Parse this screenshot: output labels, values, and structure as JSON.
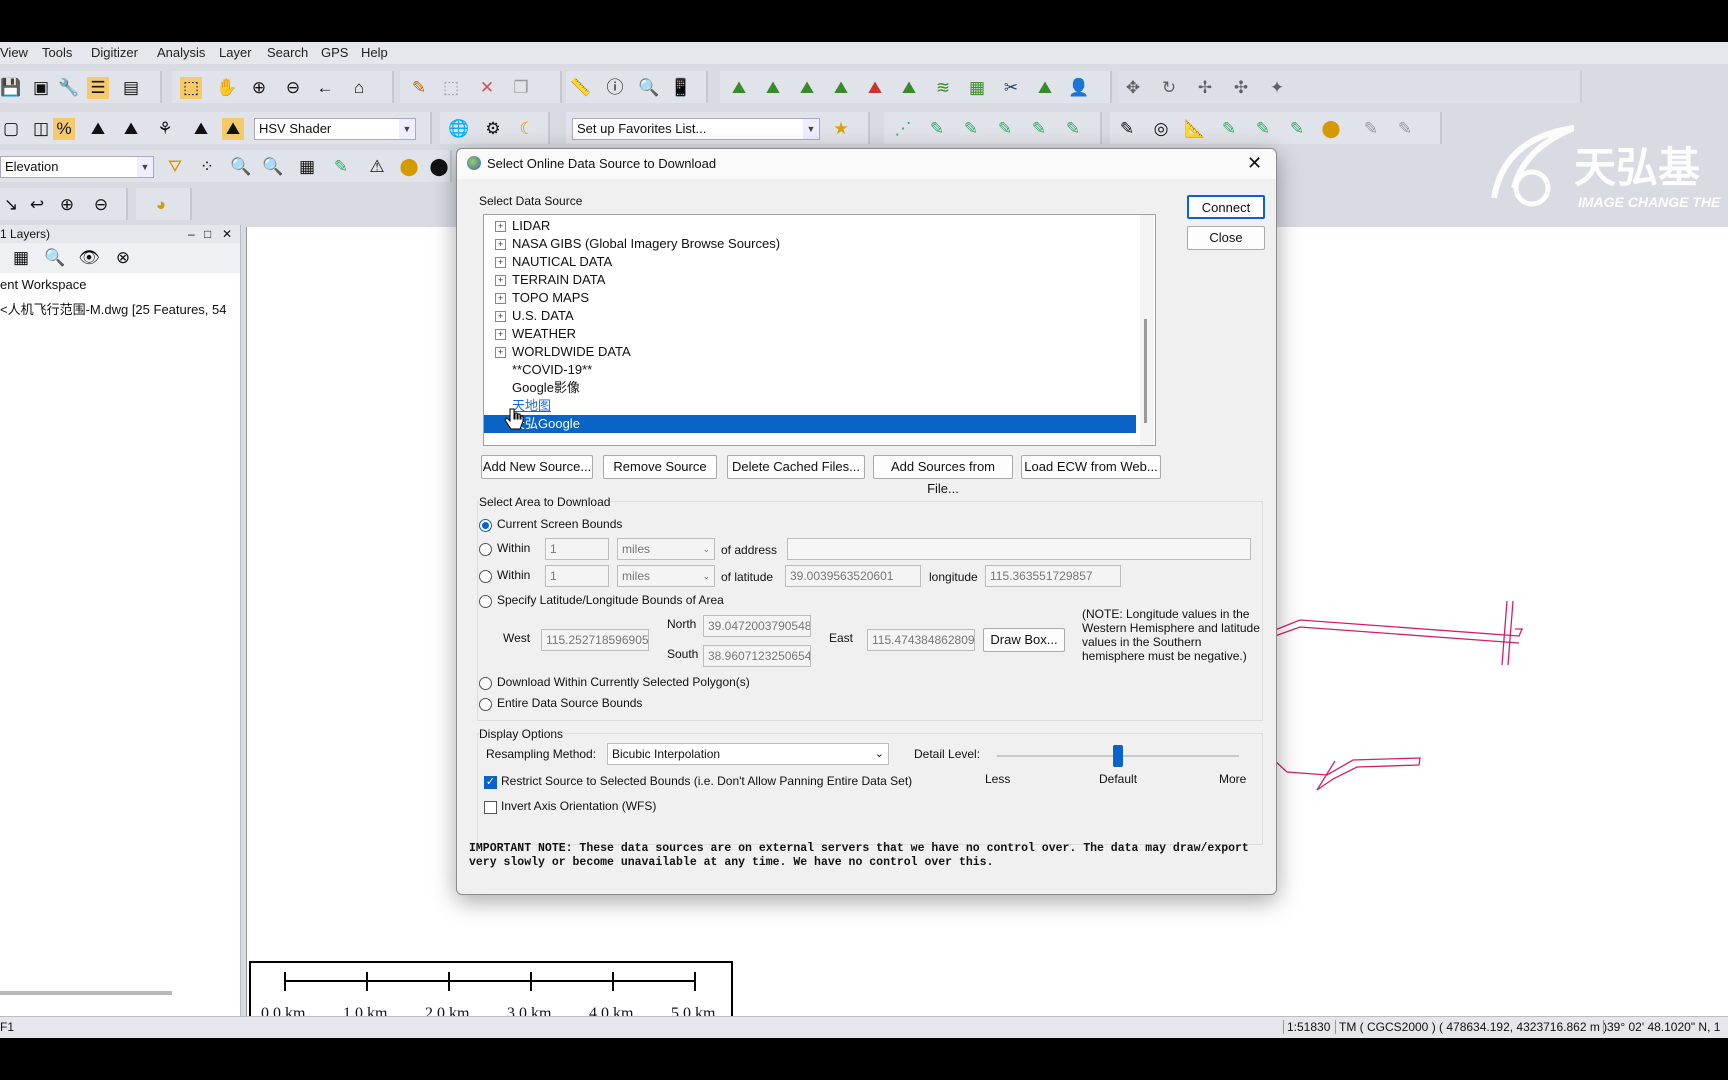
{
  "menu": [
    "View",
    "Tools",
    "Digitizer",
    "Analysis",
    "Layer",
    "Search",
    "GPS",
    "Help"
  ],
  "toolbar": {
    "shader": "HSV Shader",
    "favorites": "Set up Favorites List...",
    "elevation": "Elevation"
  },
  "logo": {
    "cn": "天弘基",
    "en": "IMAGE CHANGE THE"
  },
  "control_center": {
    "header": "1 Layers)",
    "workspace": "ent Workspace",
    "layer": "<人机飞行范围-M.dwg [25 Features, 54"
  },
  "dialog": {
    "title": "Select Online Data Source to Download",
    "connect": "Connect",
    "close": "Close",
    "select_source_label": "Select Data Source",
    "sources": [
      {
        "label": "LIDAR",
        "expandable": true
      },
      {
        "label": "NASA GIBS (Global Imagery Browse Sources)",
        "expandable": true
      },
      {
        "label": "NAUTICAL DATA",
        "expandable": true
      },
      {
        "label": "TERRAIN DATA",
        "expandable": true
      },
      {
        "label": "TOPO MAPS",
        "expandable": true
      },
      {
        "label": "U.S. DATA",
        "expandable": true
      },
      {
        "label": "WEATHER",
        "expandable": true
      },
      {
        "label": "WORLDWIDE DATA",
        "expandable": true
      },
      {
        "label": "**COVID-19**",
        "expandable": false
      },
      {
        "label": "Google影像",
        "expandable": false
      },
      {
        "label": "天地图",
        "expandable": false
      },
      {
        "label": "天弘Google",
        "expandable": false
      }
    ],
    "selected_source_index": 11,
    "buttons": {
      "add": "Add New Source...",
      "remove": "Remove Source",
      "delete_cache": "Delete Cached Files...",
      "add_file": "Add Sources from File...",
      "load_ecw": "Load ECW from Web..."
    },
    "area": {
      "label": "Select Area to Download",
      "current_bounds": "Current Screen Bounds",
      "within": "Within",
      "within_value": "1",
      "units": "miles",
      "of_address": "of address",
      "of_latitude": "of latitude",
      "latitude_value": "39.0039563520601",
      "longitude_label": "longitude",
      "longitude_value": "115.363551729857",
      "specify_bounds": "Specify Latitude/Longitude Bounds of Area",
      "west_label": "West",
      "west_value": "115.252718596905",
      "north_label": "North",
      "north_value": "39.0472003790548",
      "east_label": "East",
      "east_value": "115.474384862809",
      "south_label": "South",
      "south_value": "38.9607123250654",
      "draw_box": "Draw Box...",
      "note": "(NOTE: Longitude values in the Western Hemisphere and latitude values in the Southern hemisphere must be negative.)",
      "selected_polygons": "Download Within Currently Selected Polygon(s)",
      "entire_bounds": "Entire Data Source Bounds"
    },
    "display": {
      "label": "Display Options",
      "resampling_label": "Resampling Method:",
      "resampling_value": "Bicubic Interpolation",
      "detail_label": "Detail Level:",
      "detail_less": "Less",
      "detail_default": "Default",
      "detail_more": "More",
      "detail_level": 0.5,
      "restrict": "Restrict Source to Selected Bounds (i.e. Don't Allow Panning Entire Data Set)",
      "restrict_checked": true,
      "invert": "Invert Axis Orientation (WFS)",
      "invert_checked": false
    },
    "important_note": "IMPORTANT NOTE: These data sources are on external servers that we have no control over. The data may draw/export very slowly or become unavailable at any time. We have no control over this."
  },
  "scale_bar": [
    "0.0 km",
    "1.0 km",
    "2.0 km",
    "3.0 km",
    "4.0 km",
    "5.0 km"
  ],
  "status": {
    "left": "F1",
    "scale": "1:51830",
    "projection": "TM ( CGCS2000 ) ( 478634.192, 4323716.862 m )",
    "coords": "39° 02' 48.1020\" N, 1"
  },
  "colors": {
    "selection": "#0a64c8",
    "link": "#1a6ad0",
    "feature": "#d0206a"
  }
}
